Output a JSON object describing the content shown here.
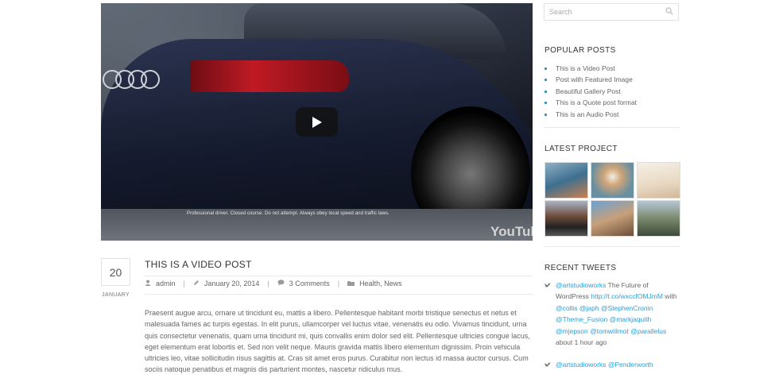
{
  "video": {
    "disclaimer": "Professional driver. Closed course. Do not attempt. Always obey local speed and traffic laws.",
    "logo_text": "YouTube"
  },
  "post": {
    "day": "20",
    "month": "JANUARY",
    "title": "THIS IS A VIDEO POST",
    "author": "admin",
    "date": "January 20, 2014",
    "comments": "3 Comments",
    "categories": "Health, News",
    "excerpt": "Praesent augue arcu, ornare ut tincidunt eu, mattis a libero. Pellentesque habitant morbi tristique senectus et netus et malesuada fames ac turpis egestas. In elit purus, ullamcorper vel luctus vitae, venenatis eu odio. Vivamus tincidunt, urna quis consectetur venenatis, quam urna tincidunt mi, quis convallis enim dolor sed elit. Pellentesque ultricies congue lacus, eget elementum erat lobortis et. Sed non velit neque. Mauris gravida mattis libero elementum dignissim. Proin vehicula ultricies leo, vitae sollicitudin risus sagittis at. Cras sit amet eros purus. Curabitur non lectus id massa auctor cursus. Cum sociis natoque penatibus et magnis dis parturient montes, nascetur ridiculus mus."
  },
  "sidebar": {
    "search_placeholder": "Search",
    "popular_title": "POPULAR POSTS",
    "popular": [
      "This is a Video Post",
      "Post with Featured Image",
      "Beautiful Gallery Post",
      "This is a Quote post format",
      "This is an Audio Post"
    ],
    "project_title": "LATEST PROJECT",
    "tweets_title": "RECENT TWEETS",
    "tweet1": {
      "handle": "@artstudioworks",
      "text": " The Future of WordPress ",
      "link": "http://t.co/wxccfOMJmM",
      "after": " with ",
      "mentions1": "@collis @japh @StephenCronin",
      "mentions2": "@Theme_Fusion @markjaquith",
      "mentions3": "@mjepson @tomwillmot @parallelus",
      "time": "about 1 hour ago"
    },
    "tweet2": {
      "handle": "@artstudioworks",
      "mention": "@Penderworth"
    }
  },
  "colors": {
    "accent": "#2aa0d8",
    "text": "#666666",
    "heading": "#333333"
  },
  "icons": [
    "play-icon",
    "search-icon",
    "user-icon",
    "pencil-icon",
    "comment-icon",
    "folder-icon",
    "twitter-icon"
  ]
}
